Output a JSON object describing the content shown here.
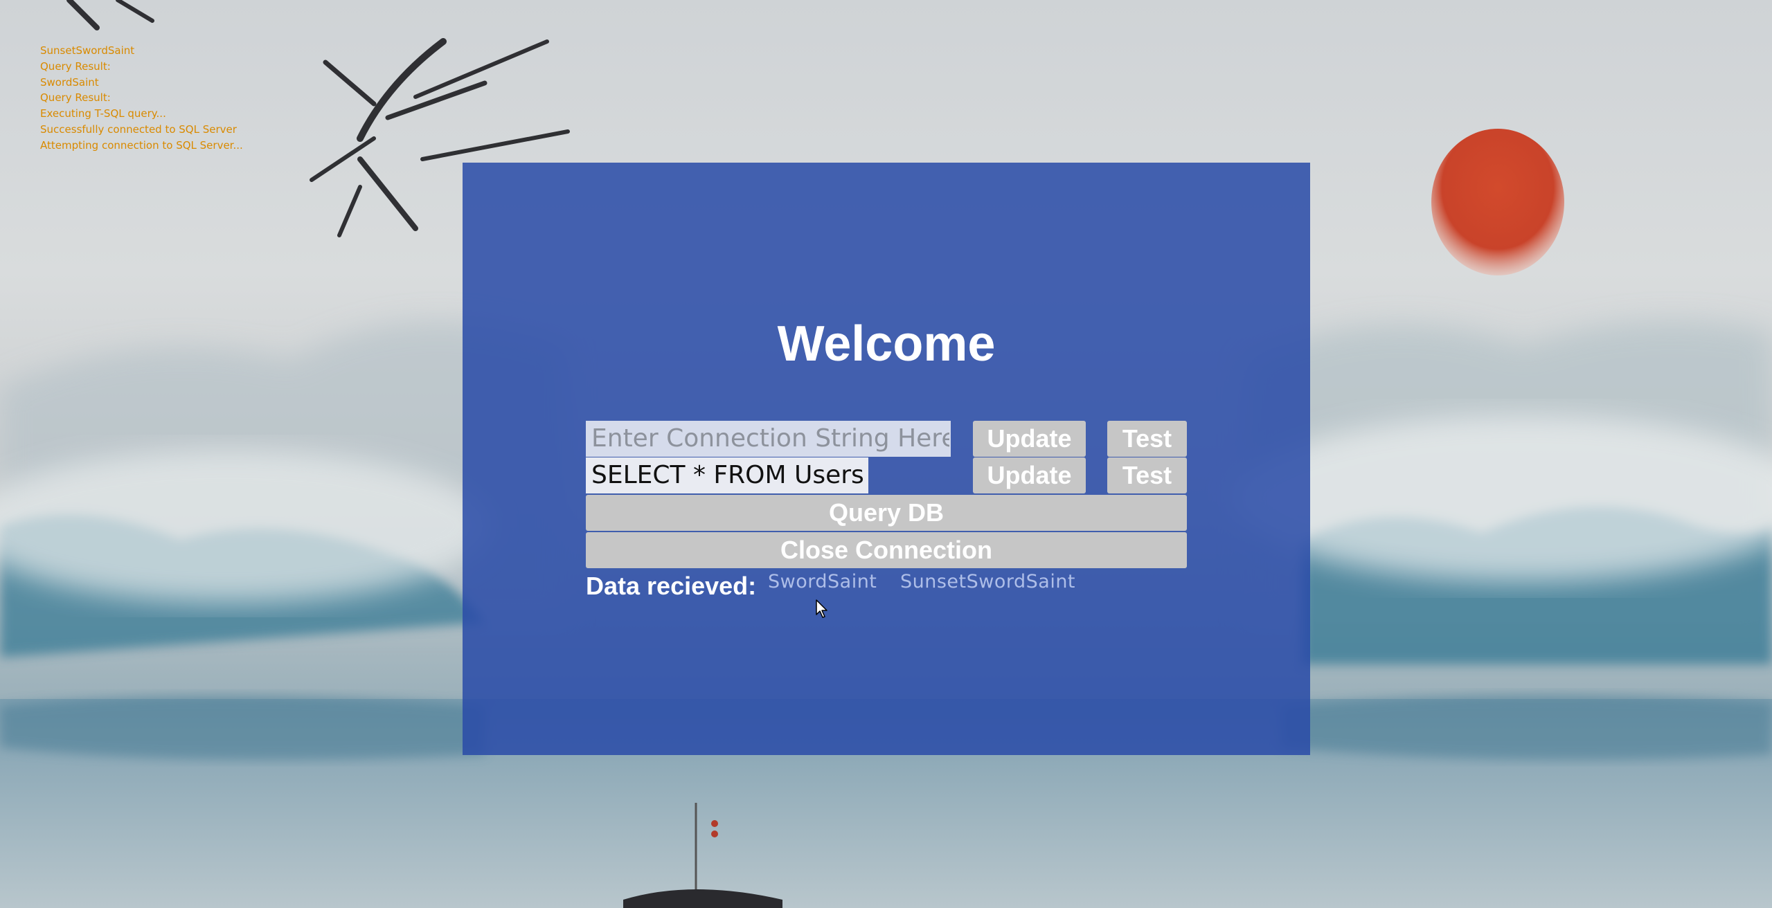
{
  "log": {
    "lines": [
      "SunsetSwordSaint",
      "Query Result:",
      "SwordSaint",
      "Query Result:",
      "Executing T-SQL query...",
      "Successfully connected to SQL Server",
      "Attempting connection to SQL Server..."
    ]
  },
  "panel": {
    "title": "Welcome",
    "connection_field": {
      "placeholder": "Enter Connection String Here:",
      "value": ""
    },
    "query_field": {
      "value": "SELECT * FROM Users"
    },
    "update_label": "Update",
    "test_label": "Test",
    "query_db_label": "Query DB",
    "close_connection_label": "Close Connection",
    "data_label": "Data recieved:",
    "data_items": [
      "SwordSaint",
      "SunsetSwordSaint"
    ]
  },
  "colors": {
    "panel": "#2a4ca8",
    "log_text": "#d98a00",
    "button": "#c6c6c6",
    "sun": "#c9432a"
  },
  "icons": {
    "cursor": "mouse-pointer-icon"
  }
}
